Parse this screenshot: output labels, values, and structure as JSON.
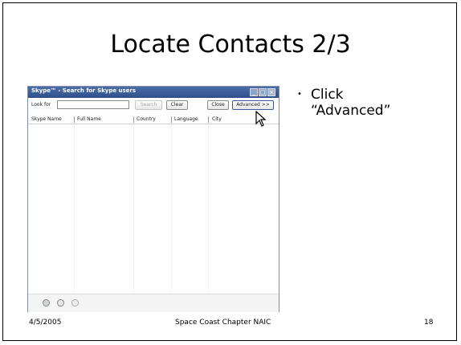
{
  "slide": {
    "title": "Locate Contacts 2/3",
    "bullet_line1": "Click",
    "bullet_line2": "“Advanced”",
    "footer_date": "4/5/2005",
    "footer_center": "Space Coast Chapter NAIC",
    "footer_page": "18"
  },
  "window": {
    "title": "Skype™ - Search for Skype users",
    "look_for_label": "Look for",
    "look_for_value": "",
    "buttons": {
      "search": "Search",
      "clear": "Clear",
      "close": "Close",
      "advanced": "Advanced >>"
    },
    "columns": [
      "Skype Name",
      "Full Name",
      "Country",
      "Language",
      "City"
    ]
  },
  "icons": {
    "minimize": "minimize-icon",
    "maximize": "maximize-icon",
    "close": "close-icon",
    "cursor": "mouse-pointer-icon",
    "status": [
      "status-icon",
      "info-icon",
      "users-icon"
    ]
  }
}
